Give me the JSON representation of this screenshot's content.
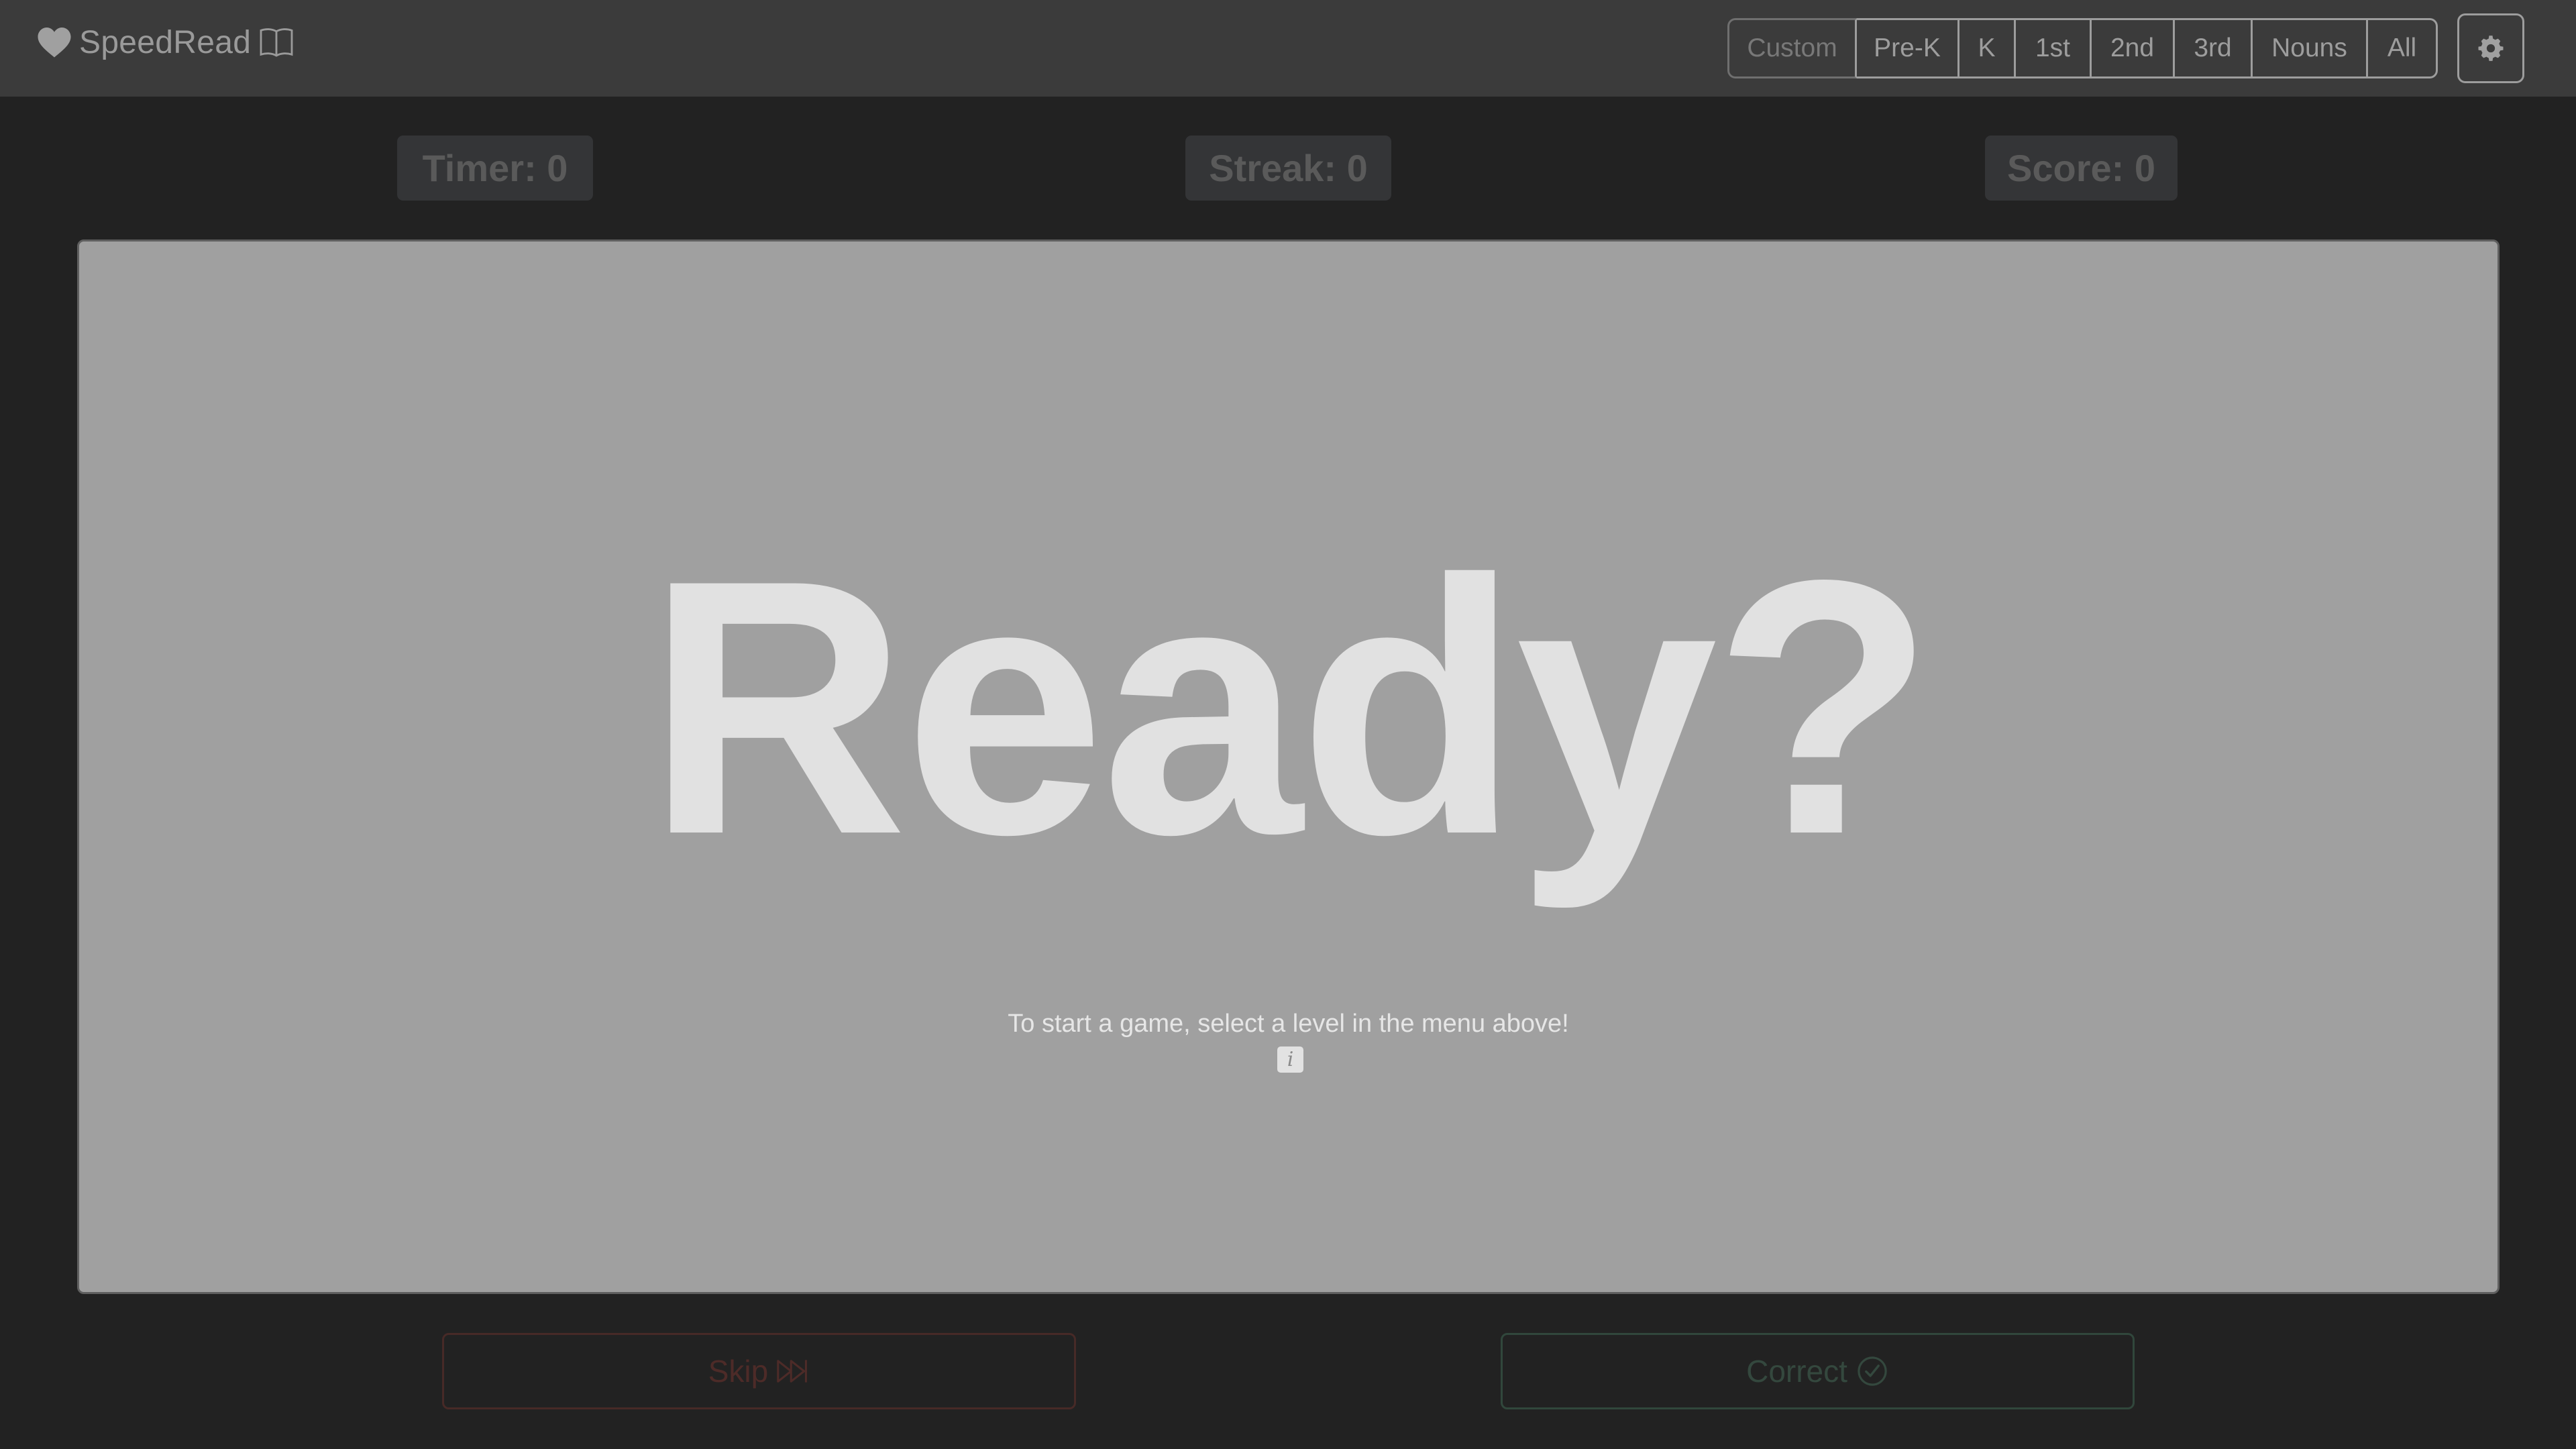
{
  "navbar": {
    "brand_name": "SpeedRead",
    "brand_left_icon": "heart-icon",
    "brand_right_icon": "book-icon",
    "levels": [
      {
        "label": "Custom",
        "state": "disabled"
      },
      {
        "label": "Pre-K"
      },
      {
        "label": "K"
      },
      {
        "label": "1st"
      },
      {
        "label": "2nd"
      },
      {
        "label": "3rd"
      },
      {
        "label": "Nouns"
      },
      {
        "label": "All"
      }
    ],
    "settings_icon": "gear-icon"
  },
  "stats": {
    "timer": "Timer: 0",
    "streak": "Streak: 0",
    "score": "Score: 0"
  },
  "card": {
    "word": "Ready?",
    "instructions": "To start a game, select a level in the menu above!",
    "info_glyph": "i"
  },
  "actions": {
    "skip_label": "Skip",
    "skip_icon": "skip-forward-icon",
    "correct_label": "Correct",
    "correct_icon": "check-circle-icon"
  },
  "colors": {
    "page_bg": "#222222",
    "navbar_bg": "#3b3b3b",
    "card_bg": "#a0a0a0",
    "word_color": "#e1e1e1",
    "skip_color": "#4d2b28",
    "correct_color": "#34483e"
  }
}
